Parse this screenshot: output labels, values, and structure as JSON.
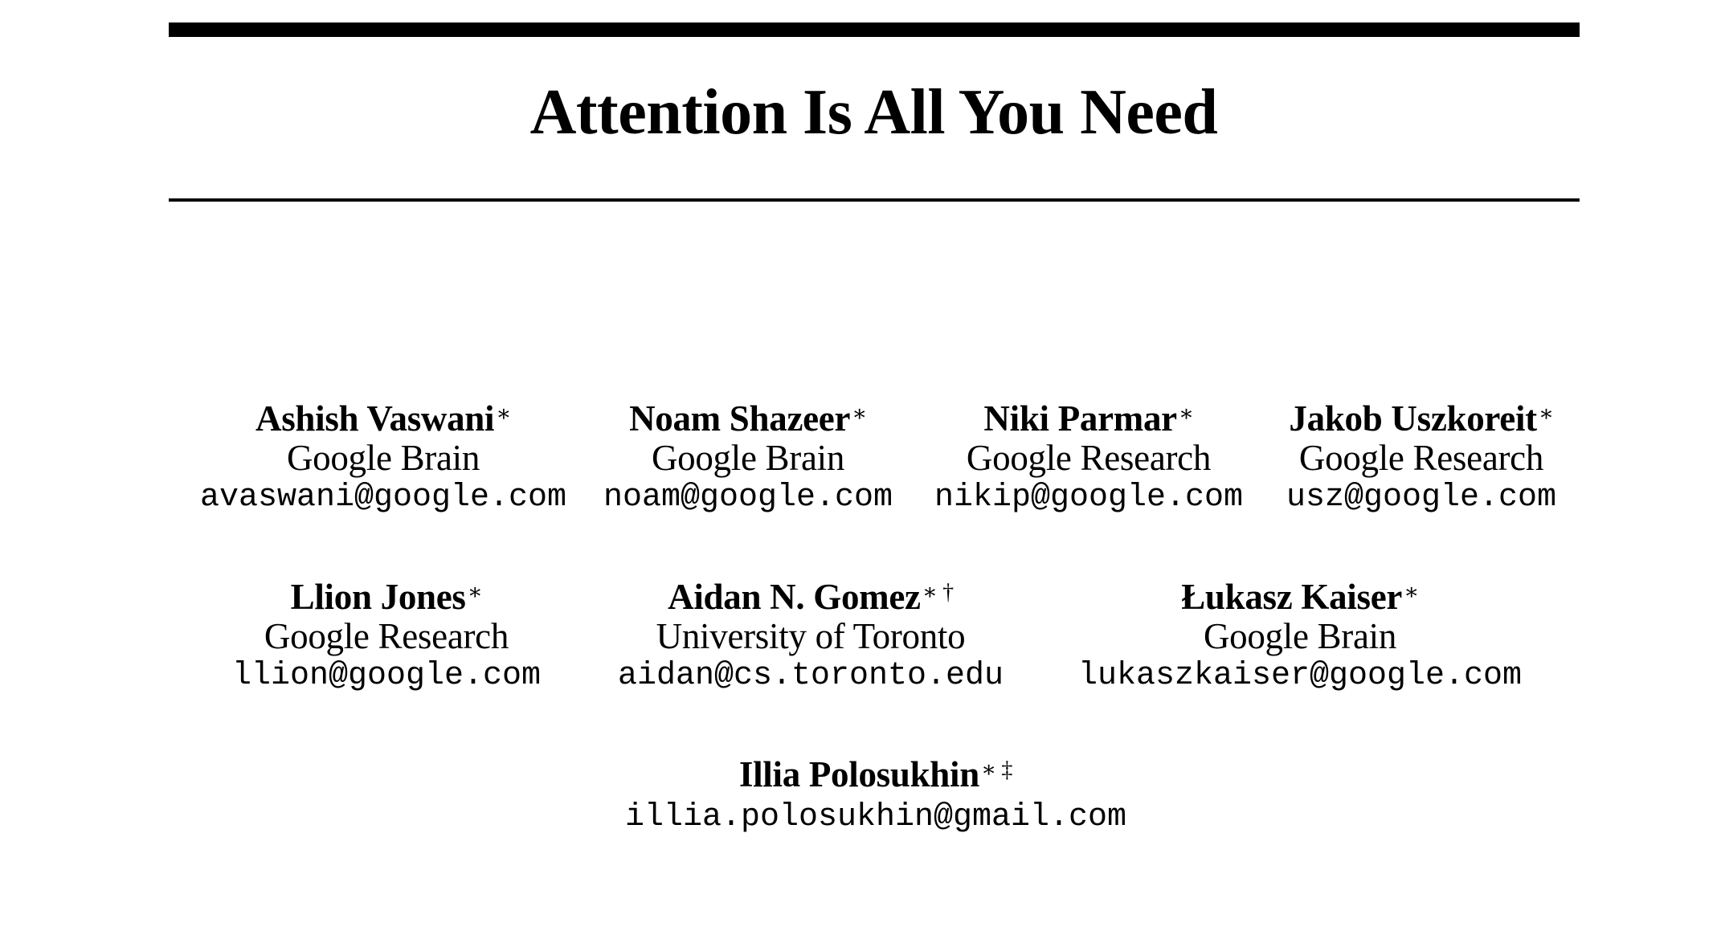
{
  "paper": {
    "title": "Attention Is All You Need"
  },
  "authors": [
    {
      "name": "Ashish Vaswani",
      "marks": "∗",
      "affiliation": "Google Brain",
      "email": "avaswani@google.com"
    },
    {
      "name": "Noam Shazeer",
      "marks": "∗",
      "affiliation": "Google Brain",
      "email": "noam@google.com"
    },
    {
      "name": "Niki Parmar",
      "marks": "∗",
      "affiliation": "Google Research",
      "email": "nikip@google.com"
    },
    {
      "name": "Jakob Uszkoreit",
      "marks": "∗",
      "affiliation": "Google Research",
      "email": "usz@google.com"
    },
    {
      "name": "Llion Jones",
      "marks": "∗",
      "affiliation": "Google Research",
      "email": "llion@google.com"
    },
    {
      "name": "Aidan N. Gomez",
      "marks": "∗ †",
      "affiliation": "University of Toronto",
      "email": "aidan@cs.toronto.edu"
    },
    {
      "name": "Łukasz Kaiser",
      "marks": "∗",
      "affiliation": "Google Brain",
      "email": "lukaszkaiser@google.com"
    },
    {
      "name": "Illia Polosukhin",
      "marks": "∗ ‡",
      "affiliation": "",
      "email": "illia.polosukhin@gmail.com"
    }
  ]
}
